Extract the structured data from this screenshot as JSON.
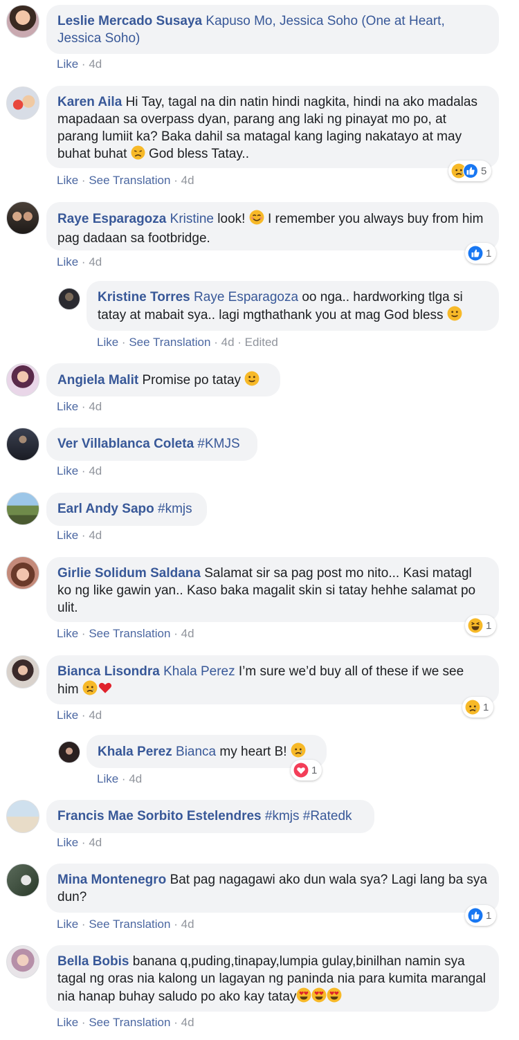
{
  "comments": [
    {
      "author": "Leslie Mercado Susaya",
      "tag": "Kapuso Mo, Jessica Soho (One at Heart, Jessica Soho)",
      "text": "",
      "actions": {
        "like": "Like",
        "time": "4d"
      }
    },
    {
      "author": "Karen Aila",
      "tag": "",
      "text": "Hi Tay, tagal na din natin hindi nagkita, hindi na ako madalas mapadaan sa overpass dyan, parang ang laki ng pinayat mo po, at parang lumiit ka? Baka dahil sa matagal kang laging nakatayo at may buhat buhat",
      "text_after": "God bless Tatay..",
      "actions": {
        "like": "Like",
        "translate": "See Translation",
        "time": "4d"
      },
      "reactions": {
        "count": "5",
        "types": [
          "sad",
          "like"
        ]
      }
    },
    {
      "author": "Raye Esparagoza",
      "tag": "Kristine",
      "text": "look!",
      "text_after": "I remember you always buy from him pag dadaan sa footbridge.",
      "actions": {
        "like": "Like",
        "time": "4d"
      },
      "reactions": {
        "count": "1",
        "types": [
          "like"
        ]
      }
    },
    {
      "author": "Kristine Torres",
      "tag": "Raye Esparagoza",
      "text": "oo nga.. hardworking tlga si tatay at mabait sya.. lagi mgthathank you at mag God bless",
      "actions": {
        "like": "Like",
        "translate": "See Translation",
        "time": "4d",
        "edited": "Edited"
      }
    },
    {
      "author": "Angiela Malit",
      "tag": "",
      "text": "Promise po tatay",
      "actions": {
        "like": "Like",
        "time": "4d"
      }
    },
    {
      "author": "Ver Villablanca Coleta",
      "tag": "#KMJS",
      "text": "",
      "actions": {
        "like": "Like",
        "time": "4d"
      }
    },
    {
      "author": "Earl Andy Sapo",
      "tag": "#kmjs",
      "text": "",
      "actions": {
        "like": "Like",
        "time": "4d"
      }
    },
    {
      "author": "Girlie Solidum Saldana",
      "tag": "",
      "text": "Salamat sir sa pag post mo nito... Kasi matagl ko ng like gawin yan.. Kaso baka magalit skin si tatay hehhe salamat po ulit.",
      "actions": {
        "like": "Like",
        "translate": "See Translation",
        "time": "4d"
      },
      "reactions": {
        "count": "1",
        "types": [
          "haha"
        ]
      }
    },
    {
      "author": "Bianca Lisondra",
      "tag": "Khala Perez",
      "text": "I’m sure we’d buy all of these if we see him",
      "actions": {
        "like": "Like",
        "time": "4d"
      },
      "reactions": {
        "count": "1",
        "types": [
          "sad"
        ]
      }
    },
    {
      "author": "Khala Perez",
      "tag": "Bianca",
      "text": "my heart B!",
      "actions": {
        "like": "Like",
        "time": "4d"
      },
      "reactions": {
        "count": "1",
        "types": [
          "love"
        ]
      }
    },
    {
      "author": "Francis Mae Sorbito Estelendres",
      "tag": "#kmjs #Ratedk",
      "text": "",
      "actions": {
        "like": "Like",
        "time": "4d"
      }
    },
    {
      "author": "Mina Montenegro",
      "tag": "",
      "text": "Bat pag nagagawi ako dun wala sya? Lagi lang ba sya dun?",
      "actions": {
        "like": "Like",
        "translate": "See Translation",
        "time": "4d"
      },
      "reactions": {
        "count": "1",
        "types": [
          "like"
        ]
      }
    },
    {
      "author": "Bella Bobis",
      "tag": "",
      "text": "banana q,puding,tinapay,lumpia gulay,binilhan namin sya tagal ng oras nia kalong un lagayan ng paninda nia para kumita marangal nia hanap buhay saludo po ako kay tatay",
      "actions": {
        "like": "Like",
        "translate": "See Translation",
        "time": "4d"
      }
    }
  ],
  "separator": "·",
  "colors": {
    "author": "#385898",
    "bubble": "#f2f3f5",
    "meta": "#90949c",
    "like_blue": "#1877f2",
    "love_red": "#f33e58",
    "emoji_yellow": "#f7b928"
  }
}
